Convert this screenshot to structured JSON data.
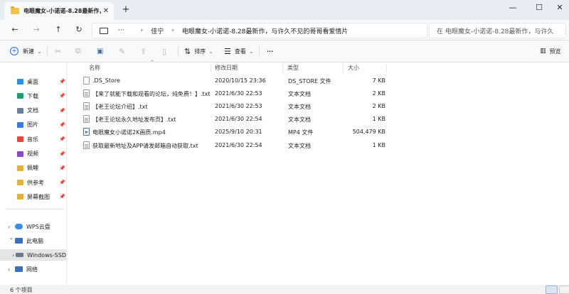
{
  "window": {
    "tab_title": "电眼魔女-小诺诺-8.28最新作，",
    "tab_close": "✕",
    "new_tab": "+",
    "minimize": "—",
    "maximize": "☐",
    "close": "✕"
  },
  "nav_buttons": {
    "back": "←",
    "forward": "→",
    "up": "↑",
    "refresh": "↻"
  },
  "address": {
    "ellipsis": "···",
    "separator": "›",
    "crumbs": [
      "佳宁",
      "电眼魔女-小诺诺-8.28最新作，与许久不见的哥哥看爱情片"
    ]
  },
  "search": {
    "placeholder": "在 电眼魔女-小诺诺-8.28最新作，与许久"
  },
  "toolbar": {
    "new_label": "新建",
    "sort_label": "排序",
    "view_label": "查看",
    "more_label": "···",
    "preview_label": "预览",
    "cut_icon": "✂",
    "copy_icon": "⧉",
    "paste_icon": "📋",
    "rename_icon": "✎",
    "share_icon": "⇪",
    "delete_icon": "🗑",
    "sort_icon": "⇅",
    "view_icon": "☰"
  },
  "quick_access": [
    {
      "label": "桌面",
      "color": "#2f8ee5"
    },
    {
      "label": "下载",
      "color": "#1f9d6b"
    },
    {
      "label": "文档",
      "color": "#6e7f95"
    },
    {
      "label": "图片",
      "color": "#3b7be0"
    },
    {
      "label": "音乐",
      "color": "#e2493d"
    },
    {
      "label": "视频",
      "color": "#8b47c9"
    },
    {
      "label": "佩鲤",
      "color": "#e6b23a"
    },
    {
      "label": "供参考",
      "color": "#e6b23a"
    },
    {
      "label": "屏幕截图",
      "color": "#e6b23a"
    }
  ],
  "pin_glyph": "📌",
  "tree": {
    "chevron": "›",
    "wps": "WPS云盘",
    "this_pc": "此电脑",
    "windows_ssd": "Windows-SSD",
    "network": "网络"
  },
  "columns": {
    "name": "名称",
    "modified": "修改日期",
    "type": "类型",
    "size": "大小",
    "sort_caret": "^"
  },
  "files": [
    {
      "name": ".DS_Store",
      "date": "2020/10/15 23:36",
      "type": "DS_STORE 文件",
      "size": "7 KB",
      "kind": "generic"
    },
    {
      "name": "【来了就能下载和观看的论坛，纯免费！】.txt",
      "date": "2021/6/30 22:53",
      "type": "文本文档",
      "size": "2 KB",
      "kind": "txt"
    },
    {
      "name": "【老王论坛介绍】.txt",
      "date": "2021/6/30 22:53",
      "type": "文本文档",
      "size": "2 KB",
      "kind": "txt"
    },
    {
      "name": "【老王论坛永久地址发布页】.txt",
      "date": "2021/6/30 22:54",
      "type": "文本文档",
      "size": "1 KB",
      "kind": "txt"
    },
    {
      "name": "电眼魔女小诺诺2K画质.mp4",
      "date": "2025/9/10 20:31",
      "type": "MP4 文件",
      "size": "504,479 KB",
      "kind": "mp4"
    },
    {
      "name": "获取最新地址及APP请发邮箱自动获取.txt",
      "date": "2021/6/30 22:54",
      "type": "文本文档",
      "size": "1 KB",
      "kind": "txt"
    }
  ],
  "status": {
    "item_count": "6 个项目"
  }
}
